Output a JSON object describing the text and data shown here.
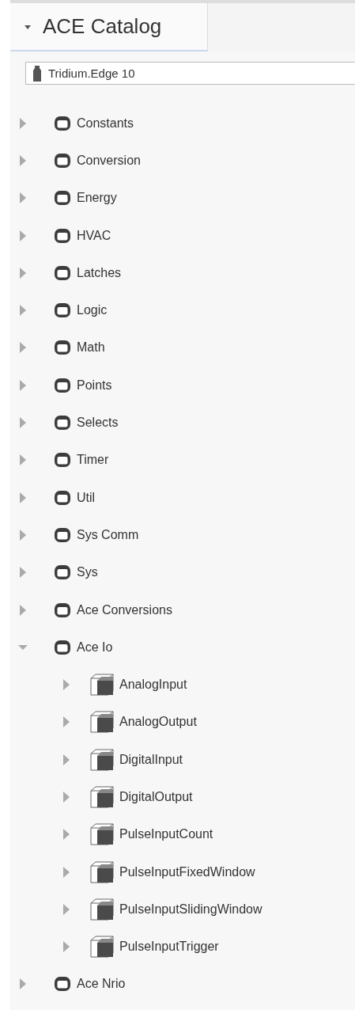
{
  "tab": {
    "label": "ACE Catalog",
    "expanded": true
  },
  "field": {
    "value": "Tridium.Edge 10"
  },
  "tree": [
    {
      "label": "Constants",
      "kind": "folder",
      "expanded": false
    },
    {
      "label": "Conversion",
      "kind": "folder",
      "expanded": false
    },
    {
      "label": "Energy",
      "kind": "folder",
      "expanded": false
    },
    {
      "label": "HVAC",
      "kind": "folder",
      "expanded": false
    },
    {
      "label": "Latches",
      "kind": "folder",
      "expanded": false
    },
    {
      "label": "Logic",
      "kind": "folder",
      "expanded": false
    },
    {
      "label": "Math",
      "kind": "folder",
      "expanded": false
    },
    {
      "label": "Points",
      "kind": "folder",
      "expanded": false
    },
    {
      "label": "Selects",
      "kind": "folder",
      "expanded": false
    },
    {
      "label": "Timer",
      "kind": "folder",
      "expanded": false
    },
    {
      "label": "Util",
      "kind": "folder",
      "expanded": false
    },
    {
      "label": "Sys Comm",
      "kind": "folder",
      "expanded": false
    },
    {
      "label": "Sys",
      "kind": "folder",
      "expanded": false
    },
    {
      "label": "Ace Conversions",
      "kind": "folder",
      "expanded": false
    },
    {
      "label": "Ace Io",
      "kind": "folder",
      "expanded": true,
      "children": [
        {
          "label": "AnalogInput",
          "kind": "component",
          "expanded": false
        },
        {
          "label": "AnalogOutput",
          "kind": "component",
          "expanded": false
        },
        {
          "label": "DigitalInput",
          "kind": "component",
          "expanded": false
        },
        {
          "label": "DigitalOutput",
          "kind": "component",
          "expanded": false
        },
        {
          "label": "PulseInputCount",
          "kind": "component",
          "expanded": false
        },
        {
          "label": "PulseInputFixedWindow",
          "kind": "component",
          "expanded": false
        },
        {
          "label": "PulseInputSlidingWindow",
          "kind": "component",
          "expanded": false
        },
        {
          "label": "PulseInputTrigger",
          "kind": "component",
          "expanded": false
        }
      ]
    },
    {
      "label": "Ace Nrio",
      "kind": "folder",
      "expanded": false
    }
  ]
}
